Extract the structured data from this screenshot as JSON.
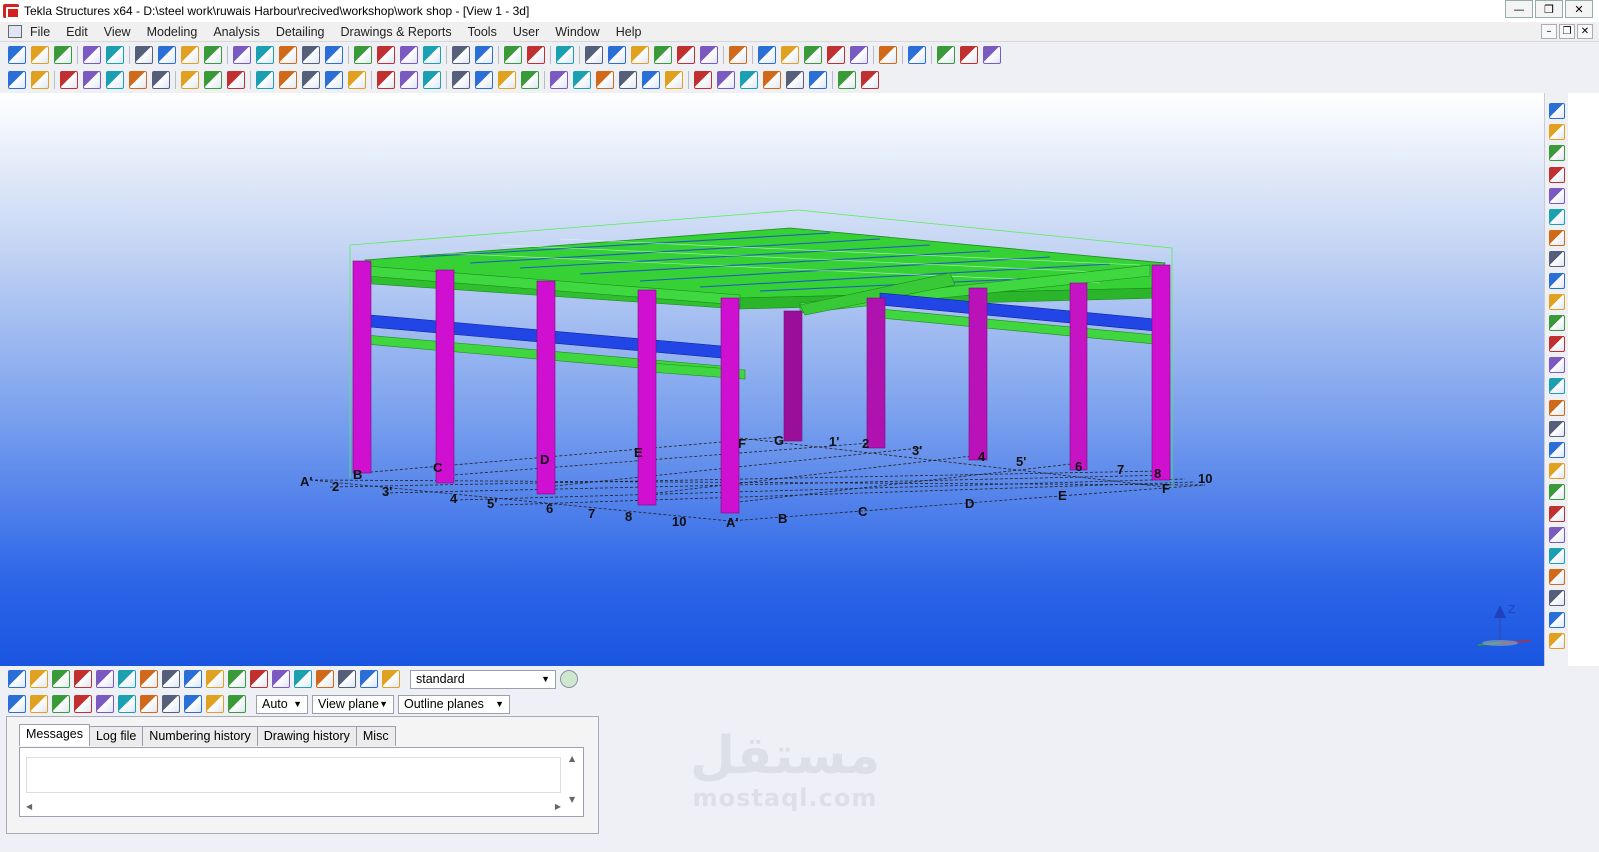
{
  "window": {
    "title": "Tekla Structures x64 - D:\\steel work\\ruwais Harbour\\recived\\workshop\\work shop  - [View 1 - 3d]",
    "controls": {
      "minimize": "—",
      "restore": "❐",
      "close": "✕"
    }
  },
  "menu": {
    "items": [
      "File",
      "Edit",
      "View",
      "Modeling",
      "Analysis",
      "Detailing",
      "Drawings & Reports",
      "Tools",
      "User",
      "Window",
      "Help"
    ],
    "mdi": {
      "minimize": "–",
      "restore": "❐",
      "close": "✕"
    }
  },
  "toolbar1": {
    "icons": [
      "new-icon",
      "open-icon",
      "save-icon",
      "sep",
      "undo-icon",
      "redo-icon",
      "sep",
      "copy-icon",
      "paste-icon",
      "properties-icon",
      "paint-icon",
      "sep",
      "rectangle-icon",
      "window-icon",
      "display-icon",
      "cut-icon",
      "clip-icon",
      "sep",
      "report-icon",
      "drawing-list-icon",
      "document-manager-icon",
      "template-icon",
      "sep",
      "snap-icon",
      "snap2-icon",
      "sep",
      "component-catalog-icon",
      "component2-icon",
      "sep",
      "help-icon",
      "sep",
      "grid-line-icon",
      "grid-icon",
      "measure-icon",
      "measure-angle-icon",
      "measure-arc-icon",
      "bolt-measure-icon",
      "sep",
      "pin-icon",
      "sep",
      "copy-special-icon",
      "move-special-icon",
      "ifc-icon",
      "export-icon",
      "import-icon",
      "sep",
      "analysis-icon",
      "sep",
      "tekla-icon",
      "sep",
      "more-icon",
      "folder-icon",
      "sketch-icon"
    ]
  },
  "toolbar2": {
    "icons": [
      "lock-icon",
      "erase-icon",
      "sep",
      "column-icon",
      "beam-icon",
      "polybeam-icon",
      "plate-icon",
      "contour-plate-icon",
      "sep",
      "bent-plate-icon",
      "weld-icon",
      "lattice-icon",
      "sep",
      "column-steel-icon",
      "beam-steel-icon",
      "polybeam-steel-icon",
      "curved-beam-icon",
      "twin-profile-icon",
      "sep",
      "concrete-column-icon",
      "footing-icon",
      "inquire-icon",
      "sep",
      "binoculars-icon",
      "pad-footing-icon",
      "strip-footing-icon",
      "slab-icon",
      "sep",
      "bolt-icon",
      "weld-part-icon",
      "cut-part-icon",
      "fitting-icon",
      "line-cut-icon",
      "polygon-cut-icon",
      "sep",
      "point-icon",
      "point-along-icon",
      "point-extension-icon",
      "intersection-icon",
      "point-arc-icon",
      "point-tangent-icon",
      "sep",
      "construction-line-icon",
      "construction-circle-icon"
    ]
  },
  "model_labels": {
    "near_axis": [
      "A'",
      "2",
      "3'",
      "4",
      "5'",
      "6",
      "7",
      "8",
      "10",
      "A'"
    ],
    "near_axis_right": [
      "B",
      "C",
      "D",
      "E",
      "F"
    ],
    "column_labels": [
      "B",
      "C",
      "D",
      "E",
      "F",
      "G",
      "1'",
      "2",
      "3'",
      "4",
      "5'",
      "6",
      "7",
      "8",
      "10"
    ]
  },
  "right_toolbar": {
    "icons": [
      "fit-icon",
      "snap-overrides-icon",
      "binoculars-icon",
      "back-arrow-icon",
      "forward-arrow-icon",
      "paragraph-icon",
      "profile-hea-icon",
      "profile-heb-icon",
      "profile-ipe-icon",
      "profile-ubp-icon",
      "profile-chs-icon",
      "profile-rhs-icon",
      "profile-l-icon",
      "profile-c-icon",
      "profile-z-icon",
      "profile-t-icon",
      "profile-pl-icon",
      "profile-fl-icon",
      "profile-d-icon",
      "profile-sq-icon",
      "profile-u-icon",
      "profile-w-icon",
      "profile-wt-icon",
      "profile-hp-icon",
      "profile-bh-icon",
      "profile-x-icon"
    ]
  },
  "selection_toolbar": {
    "icons": [
      "select-all-icon",
      "select-parts-icon",
      "select-surface-icon",
      "select-points-icon",
      "select-grid-icon",
      "select-gridline-icon",
      "select-components-icon",
      "select-bolts-icon",
      "select-welds-icon",
      "select-cuts-icon",
      "select-views-icon",
      "select-reinforcement-icon",
      "select-assemblies-icon",
      "select-objects-icon",
      "select-in-component-icon",
      "select-in-assembly-icon",
      "select-filter-icon",
      "select-toggle-icon"
    ],
    "filter_value": "standard"
  },
  "snap_toolbar": {
    "icons": [
      "snap-reference-icon",
      "snap-geometry-icon",
      "snap-nearest-icon",
      "snap-any-icon",
      "snap-line-icon",
      "snap-orthogonal-icon",
      "snap-center-icon",
      "snap-points-icon",
      "snap-intersect-icon",
      "snap-midpoint-icon",
      "snap-override-icon"
    ],
    "plane_depth": "Auto",
    "plane": "View plane",
    "outline": "Outline planes"
  },
  "messages_panel": {
    "tabs": [
      "Messages",
      "Log file",
      "Numbering history",
      "Drawing history",
      "Misc"
    ],
    "active_tab": "Messages"
  },
  "watermark": {
    "arabic": "مستقل",
    "latin": "mostaql.com"
  },
  "axis_gizmo": {
    "z": "Z"
  },
  "colors": {
    "column": "#d010d0",
    "beam": "#33cc33",
    "brace": "#1f3fe0",
    "sky_top": "#ffffff",
    "sky_bottom": "#1a55e0"
  }
}
